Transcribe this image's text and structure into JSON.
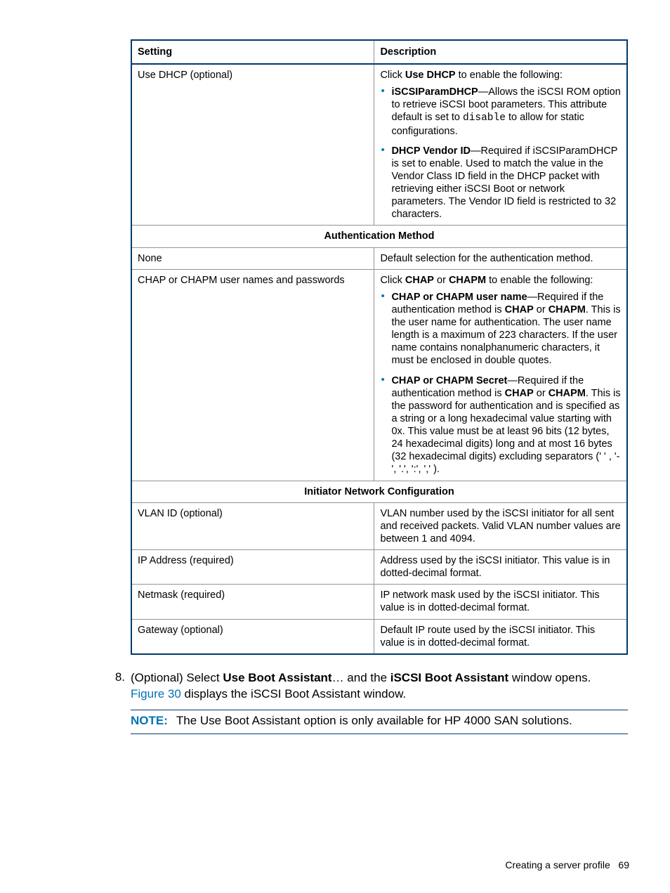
{
  "table": {
    "headers": {
      "setting": "Setting",
      "description": "Description"
    },
    "rows": {
      "use_dhcp": {
        "setting": "Use DHCP (optional)",
        "intro_pre": "Click ",
        "intro_bold": "Use DHCP",
        "intro_post": " to enable the following:",
        "bullet1_bold": "iSCSIParamDHCP",
        "bullet1_text_a": "—Allows the iSCSI ROM option to retrieve iSCSI boot parameters. This attribute default is set to ",
        "bullet1_mono": "disable",
        "bullet1_text_b": " to allow for static configurations.",
        "bullet2_bold": "DHCP Vendor ID",
        "bullet2_text": "—Required if iSCSIParamDHCP is set to enable. Used to match the value in the Vendor Class ID field in the DHCP packet with retrieving either iSCSI Boot or network parameters. The Vendor ID field is restricted to 32 characters."
      },
      "section_auth": "Authentication Method",
      "auth_none": {
        "setting": "None",
        "desc": "Default selection for the authentication method."
      },
      "chap": {
        "setting": "CHAP or CHAPM user names and passwords",
        "intro_a": "Click ",
        "intro_b1": "CHAP",
        "intro_mid": " or ",
        "intro_b2": "CHAPM",
        "intro_c": " to enable the following:",
        "b1_bold": "CHAP or CHAPM user name",
        "b1_a": "—Required if the authentication method is ",
        "b1_chap": "CHAP",
        "b1_or": " or ",
        "b1_chapm": "CHAPM",
        "b1_rest": ". This is the user name for authentication. The user name length is a maximum of 223 characters. If the user name contains nonalphanumeric characters, it must be enclosed in double quotes.",
        "b2_bold": "CHAP or CHAPM Secret",
        "b2_a": "—Required if the authentication method is ",
        "b2_chap": "CHAP",
        "b2_or": " or ",
        "b2_chapm": "CHAPM",
        "b2_rest": ". This is the password for authentication and is specified as a string or a long hexadecimal value starting with 0x. This value must be at least 96 bits (12 bytes, 24 hexadecimal digits) long and at most 16 bytes (32 hexadecimal digits) excluding separators (' ' , '-', '.', ':', ',' )."
      },
      "section_init": "Initiator Network Configuration",
      "vlan": {
        "setting": "VLAN ID (optional)",
        "desc": "VLAN number used by the iSCSI initiator for all sent and received packets. Valid VLAN number values are between 1 and 4094."
      },
      "ip": {
        "setting": "IP Address (required)",
        "desc": "Address used by the iSCSI initiator. This value is in dotted-decimal format."
      },
      "netmask": {
        "setting": "Netmask (required)",
        "desc": "IP network mask used by the iSCSI initiator. This value is in dotted-decimal format."
      },
      "gateway": {
        "setting": "Gateway (optional)",
        "desc": "Default IP route used by the iSCSI initiator. This value is in dotted-decimal format."
      }
    }
  },
  "step": {
    "number": "8.",
    "text_a": "(Optional) Select ",
    "bold1": "Use Boot Assistant",
    "text_b": "… and the ",
    "bold2": "iSCSI Boot Assistant",
    "text_c": " window opens. ",
    "figref": "Figure 30",
    "text_d": " displays the iSCSI Boot Assistant window."
  },
  "note": {
    "label": "NOTE:",
    "text": "The Use Boot Assistant option is only available for HP 4000 SAN solutions."
  },
  "footer": {
    "title": "Creating a server profile",
    "page": "69"
  }
}
